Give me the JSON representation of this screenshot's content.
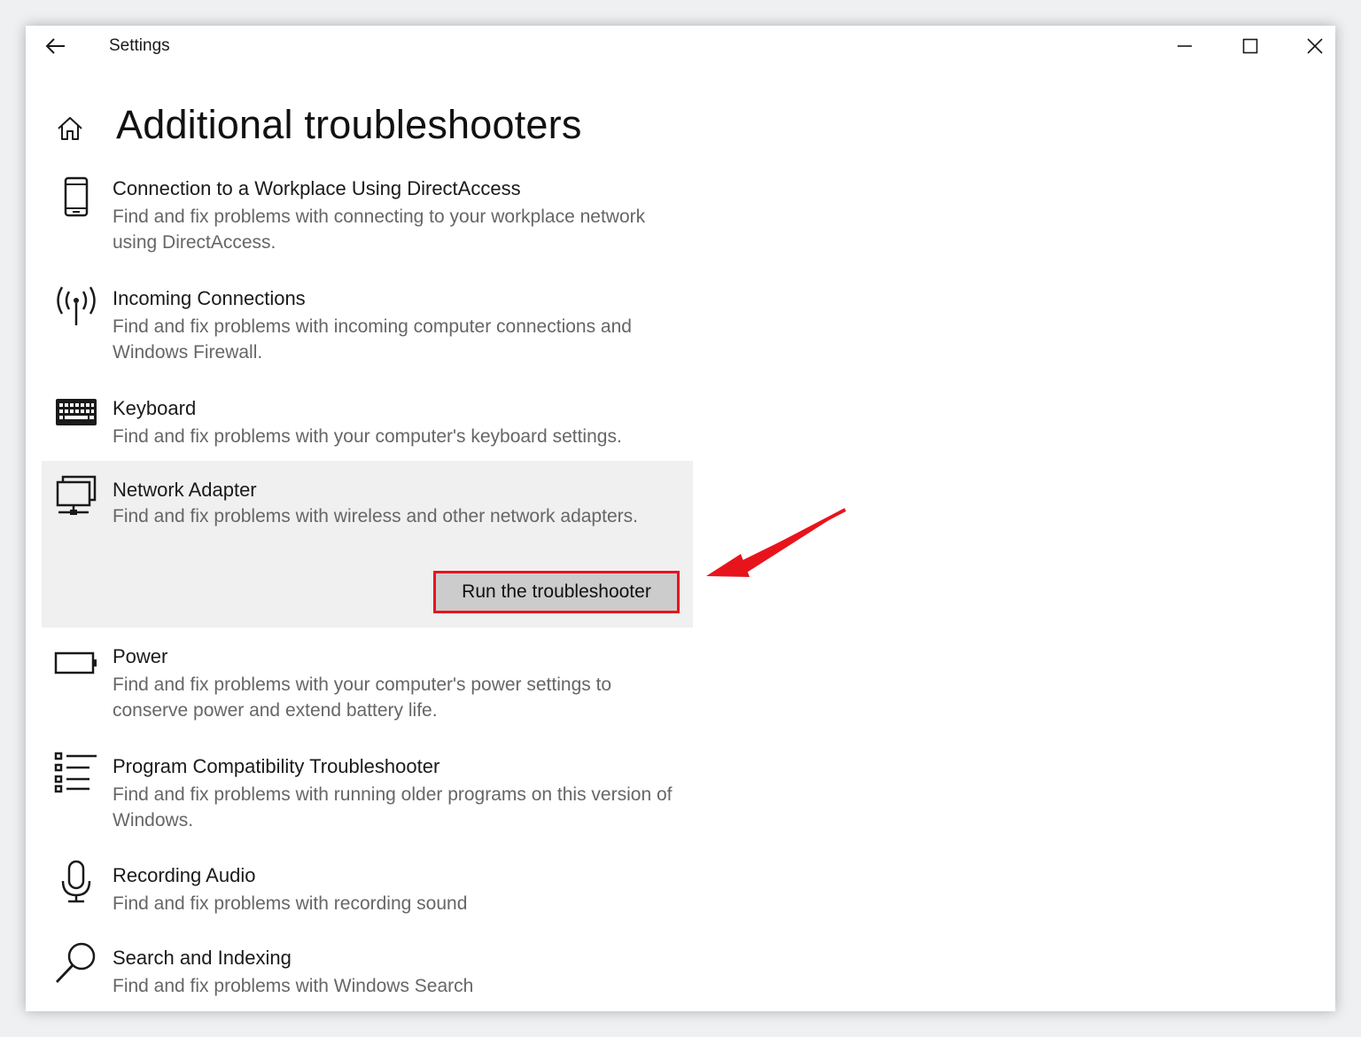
{
  "window": {
    "title": "Settings",
    "controls": [
      "minimize-icon",
      "maximize-icon",
      "close-icon"
    ]
  },
  "header": {
    "title": "Additional troubleshooters"
  },
  "troubleshooters": [
    {
      "icon": "phone-icon",
      "title": "Connection to a Workplace Using DirectAccess",
      "description": "Find and fix problems with connecting to your workplace network using DirectAccess."
    },
    {
      "icon": "antenna-icon",
      "title": "Incoming Connections",
      "description": "Find and fix problems with incoming computer connections and Windows Firewall."
    },
    {
      "icon": "keyboard-icon",
      "title": "Keyboard",
      "description": "Find and fix problems with your computer's keyboard settings."
    },
    {
      "icon": "network-adapter-icon",
      "title": "Network Adapter",
      "description": "Find and fix problems with wireless and other network adapters.",
      "action_label": "Run the troubleshooter"
    },
    {
      "icon": "battery-icon",
      "title": "Power",
      "description": "Find and fix problems with your computer's power settings to conserve power and extend battery life."
    },
    {
      "icon": "list-icon",
      "title": "Program Compatibility Troubleshooter",
      "description": "Find and fix problems with running older programs on this version of Windows."
    },
    {
      "icon": "microphone-icon",
      "title": "Recording Audio",
      "description": "Find and fix problems with recording sound"
    },
    {
      "icon": "search-icon",
      "title": "Search and Indexing",
      "description": "Find and fix problems with Windows Search"
    }
  ],
  "colors": {
    "highlight_border": "#e8141c",
    "selected_background": "#f0f0f0",
    "button_background": "#cccccc"
  }
}
